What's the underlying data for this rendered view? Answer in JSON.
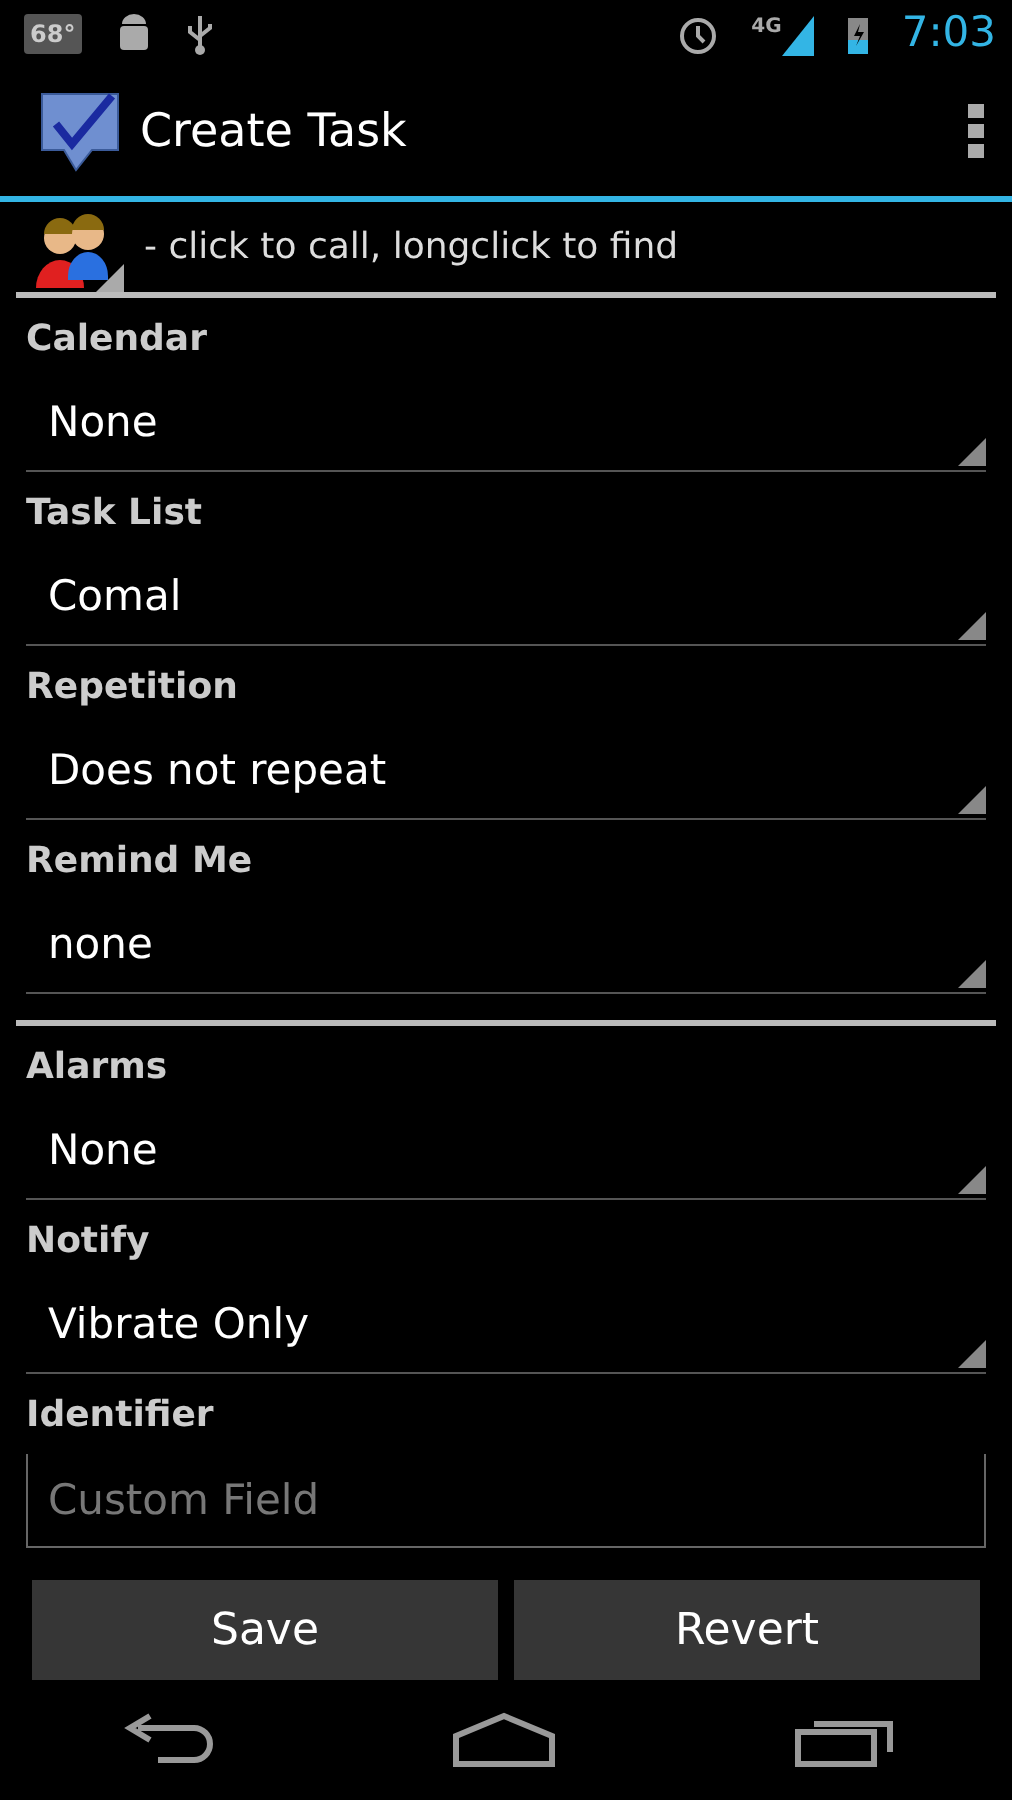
{
  "status_bar": {
    "temperature": "68°",
    "network": "4G",
    "time": "7:03"
  },
  "action_bar": {
    "title": "Create Task"
  },
  "contact_hint": "- click to call, longclick to find",
  "groups": [
    {
      "fields": [
        {
          "label": "Calendar",
          "kind": "spinner",
          "value": "None"
        },
        {
          "label": "Task List",
          "kind": "spinner",
          "value": "Comal"
        },
        {
          "label": "Repetition",
          "kind": "spinner",
          "value": "Does not repeat"
        },
        {
          "label": "Remind Me",
          "kind": "spinner",
          "value": "none"
        }
      ]
    },
    {
      "fields": [
        {
          "label": "Alarms",
          "kind": "spinner",
          "value": "None"
        },
        {
          "label": "Notify",
          "kind": "spinner",
          "value": "Vibrate Only"
        },
        {
          "label": "Identifier",
          "kind": "text",
          "placeholder": "Custom Field"
        }
      ]
    }
  ],
  "buttons": [
    "Save",
    "Revert"
  ]
}
